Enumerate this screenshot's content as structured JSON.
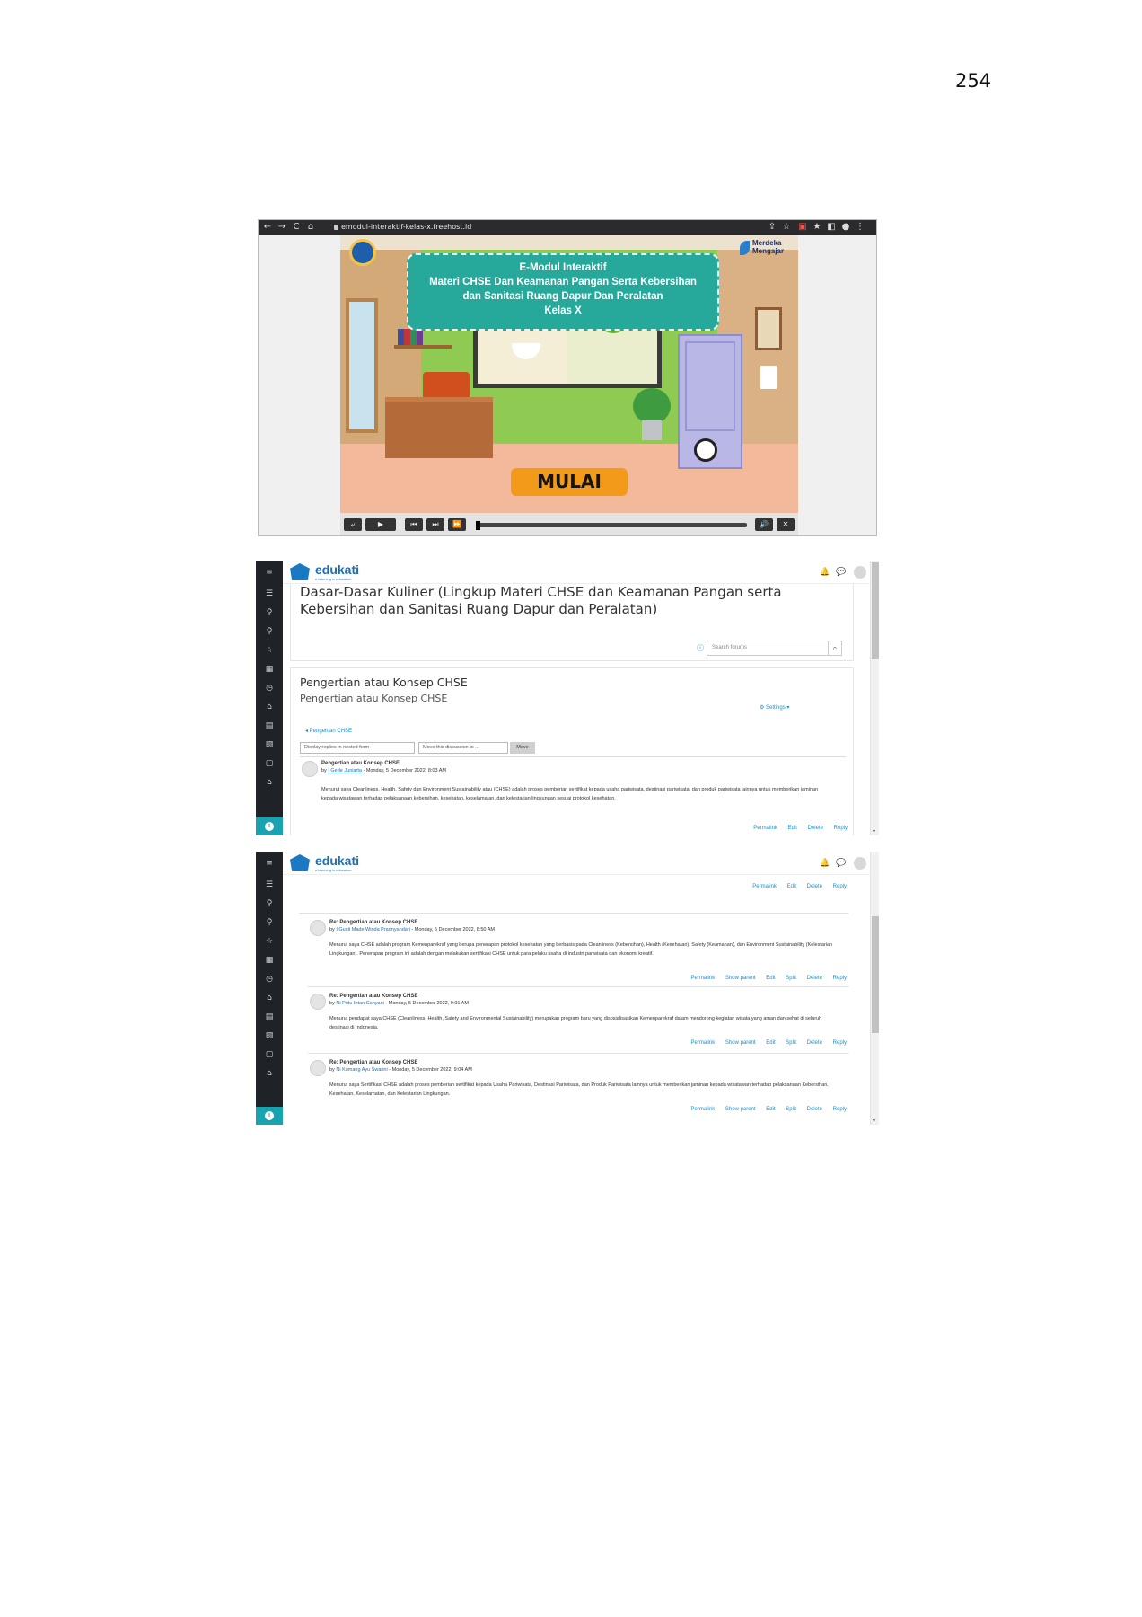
{
  "page_number": "254",
  "browser": {
    "url": "emodul-interaktif-kelas-x.freehost.id",
    "nav": [
      "←",
      "→",
      "C",
      "⌂"
    ],
    "tools": [
      "⇪",
      "☆",
      "▣",
      "★",
      "◧",
      "●",
      "⋮"
    ]
  },
  "emodule": {
    "title_lines": [
      "E-Modul Interaktif",
      "Materi CHSE Dan Keamanan Pangan Serta Kebersihan",
      "dan Sanitasi Ruang Dapur Dan Peralatan",
      "Kelas X"
    ],
    "merdeka_line1": "Merdeka",
    "merdeka_line2": "Mengajar",
    "start_button": "MULAI",
    "controls": {
      "left": [
        "⤶",
        "▶",
        "⏮",
        "⏭",
        "⏩"
      ],
      "right": [
        "🔊",
        "✕"
      ]
    },
    "progress": 0.0
  },
  "moodle": {
    "brand": "edukati",
    "brand_sub": "e-learning in education",
    "sidebar_icons": [
      "≡",
      "☰",
      "⚲",
      "⚲",
      "☆",
      "▦",
      "◷",
      "⌂",
      "▤",
      "▧",
      "▢",
      "⌂"
    ],
    "header_icons": [
      "🔔",
      "💬"
    ],
    "header_caret": "▾",
    "course_title": "Dasar-Dasar Kuliner (Lingkup Materi CHSE dan Keamanan Pangan serta Kebersihan dan Sanitasi Ruang Dapur dan Peralatan)",
    "search_placeholder": "Search forums",
    "search_button": "⌕",
    "help_icon": "ⓘ",
    "discussion_title": "Pengertian atau Konsep CHSE",
    "discussion_subtitle": "Pengertian atau Konsep CHSE",
    "settings_label": "⚙ Settings ▾",
    "back_link": "◂ Pengertian CHSE",
    "display_select": "Display replies in nested form",
    "move_select": "Move this discussion to ...",
    "move_button": "Move",
    "first_post": {
      "title": "Pengertian atau Konsep CHSE",
      "by": "by",
      "author": "I Gede Juniarta",
      "date": "- Monday, 5 December 2022, 8:03 AM",
      "body": "Menurut saya Cleanliness, Health, Safety dan Environment Sustainability atau (CHSE) adalah proses pemberian sertifikat kepada usaha pariwisata, destinasi pariwisata, dan produk pariwisata lainnya untuk memberikan jaminan kepada wisatawan terhadap pelaksanaan kebersihan, kesehatan, keselamatan, dan kelestarian lingkungan sesuai protokol kesehatan.",
      "actions": [
        "Permalink",
        "Edit",
        "Delete",
        "Reply"
      ]
    },
    "replies": [
      {
        "title": "Re: Pengertian atau Konsep CHSE",
        "by": "by",
        "author": "I Gusti Made Winda Pradnyandari",
        "date": "- Monday, 5 December 2022, 8:50 AM",
        "body": "Menurut saya CHSE adalah program Kemenparekraf yang berupa penerapan protokol kesehatan yang berbasis pada Cleanliness (Kebersihan), Health (Kesehatan), Safety (Keamanan), dan Environment Sustainability (Kelestarian Lingkungan). Penerapan program ini adalah dengan melakukan sertifikasi CHSE untuk para pelaku usaha di industri pariwisata dan ekonomi kreatif.",
        "actions": [
          "Permalink",
          "Show parent",
          "Edit",
          "Split",
          "Delete",
          "Reply"
        ]
      },
      {
        "title": "Re: Pengertian atau Konsep CHSE",
        "by": "by",
        "author": "Ni Putu Intan Cahyani",
        "date": "- Monday, 5 December 2022, 9:01 AM",
        "body": "Menurut pendapat saya CHSE (Cleanliness, Health, Safety and Environmental Sustainability) merupakan program baru yang disosialisasikan Kemenparekraf dalam mendorong kegiatan wisata yang aman dan sehat di seluruh destinasi di Indonesia.",
        "actions": [
          "Permalink",
          "Show parent",
          "Edit",
          "Split",
          "Delete",
          "Reply"
        ]
      },
      {
        "title": "Re: Pengertian atau Konsep CHSE",
        "by": "by",
        "author": "Ni Komang Ayu Swarini",
        "date": "- Monday, 5 December 2022, 9:04 AM",
        "body": "Menurut saya Sertifikasi CHSE adalah proses pemberian sertifikat kepada Usaha Pariwisata, Destinasi Pariwisata, dan Produk Pariwisata lainnya untuk memberikan jaminan kepada wisatawan terhadap pelaksanaan Kebersihan, Kesehatan, Keselamatan, dan Kelestarian Lingkungan.",
        "actions": [
          "Permalink",
          "Show parent",
          "Edit",
          "Split",
          "Delete",
          "Reply"
        ]
      }
    ]
  }
}
